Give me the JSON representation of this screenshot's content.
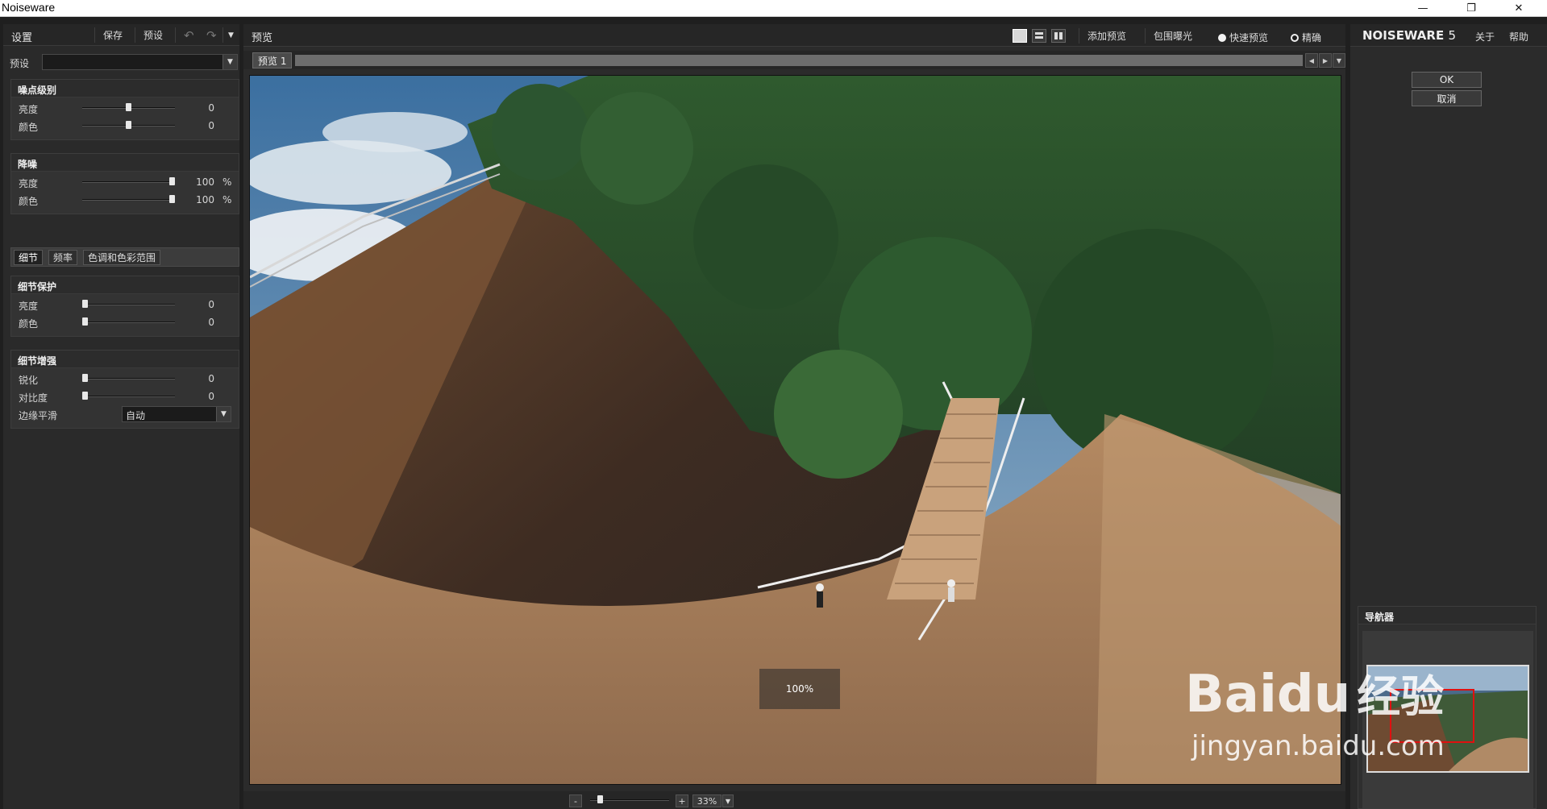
{
  "window": {
    "title": "Noiseware",
    "minimize": "—",
    "restore": "❐",
    "close": "✕"
  },
  "left_panel": {
    "header_title": "设置",
    "save": "保存",
    "presets": "预设",
    "undo": "↶",
    "redo": "↷",
    "dropdown": "▼",
    "preset_label": "预设",
    "preset_value": "",
    "noise_level": {
      "title": "噪点级别",
      "rows": [
        {
          "label": "亮度",
          "value": "0",
          "level": 0.5
        },
        {
          "label": "颜色",
          "value": "0",
          "level": 0.5
        }
      ]
    },
    "noise_reduction": {
      "title": "降噪",
      "rows": [
        {
          "label": "亮度",
          "value": "100",
          "unit": "%",
          "level": 1.0
        },
        {
          "label": "颜色",
          "value": "100",
          "unit": "%",
          "level": 1.0
        }
      ]
    },
    "tabs": [
      "细节",
      "频率",
      "色调和色彩范围"
    ],
    "detail_protection": {
      "title": "细节保护",
      "rows": [
        {
          "label": "亮度",
          "value": "0",
          "level": 0.0
        },
        {
          "label": "颜色",
          "value": "0",
          "level": 0.0
        }
      ]
    },
    "detail_enhancement": {
      "title": "细节增强",
      "rows": [
        {
          "label": "锐化",
          "value": "0",
          "level": 0.0
        },
        {
          "label": "对比度",
          "value": "0",
          "level": 0.0
        }
      ],
      "edge_label": "边缘平滑",
      "edge_value": "自动"
    }
  },
  "center_panel": {
    "header_title": "预览",
    "add_preview": "添加预览",
    "bracket": "包围曝光",
    "fast_preview": "快速预览",
    "accurate": "精确",
    "preview_tab": "预览 1",
    "nav_left": "◀",
    "nav_right": "▶",
    "nav_down": "▼",
    "zoom_overlay": "100%",
    "zoom_minus": "-",
    "zoom_plus": "+",
    "zoom_value": "33%",
    "zoom_dropdown": "▼",
    "zoom_level": 0.1
  },
  "right_panel": {
    "brand": "NOISEWARE",
    "version": "5",
    "about": "关于",
    "help": "帮助",
    "ok": "OK",
    "cancel": "取消",
    "navigator_title": "导航器"
  },
  "watermark": {
    "text_main": "Bai",
    "text_paw": "du",
    "text_cn": "经验",
    "url": "jingyan.baidu.com"
  }
}
